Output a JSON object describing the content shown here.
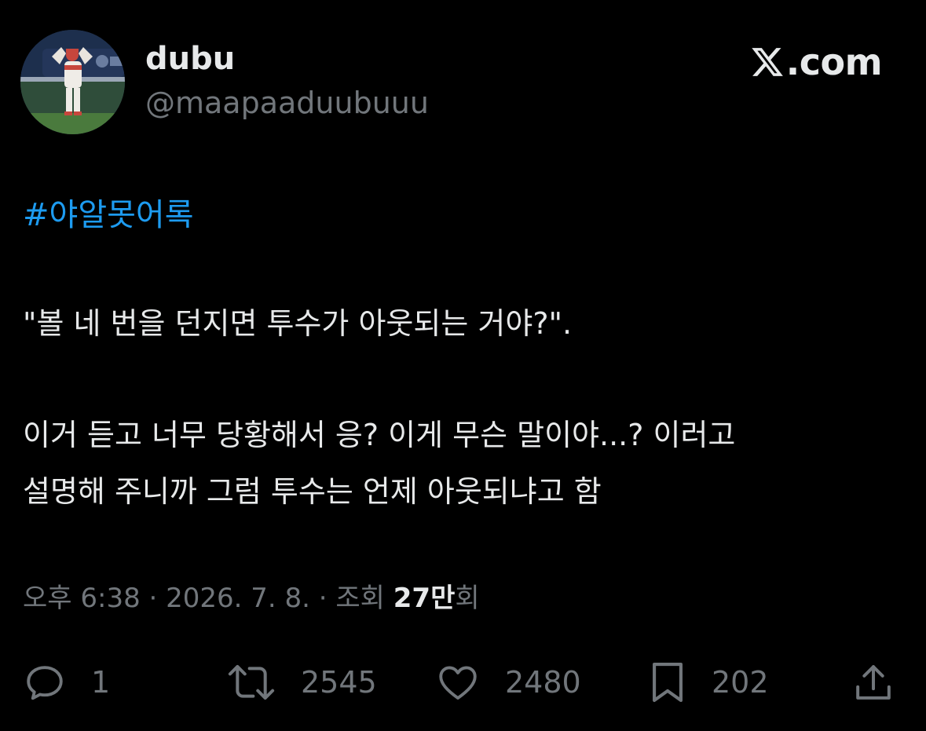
{
  "author": {
    "display_name": "dubu",
    "handle": "@maapaaduubuuu",
    "avatar_icon": "baseball-player-avatar"
  },
  "brand": {
    "icon": "x-logo-icon",
    "text": ".com"
  },
  "tweet": {
    "hashtag": "#야알못어록",
    "lines": [
      "\"볼 네 번을 던지면 투수가 아웃되는 거야?\".",
      "이거 듣고 너무 당황해서 응? 이게 무슨 말이야...? 이러고",
      "설명해 주니까 그럼 투수는 언제 아웃되냐고 함"
    ]
  },
  "meta": {
    "time": "오후 6:38 · 2026. 7. 8. · 조회 ",
    "views_count": "27만",
    "views_suffix": "회"
  },
  "actions": {
    "reply": {
      "icon": "reply-icon",
      "count": "1"
    },
    "retweet": {
      "icon": "retweet-icon",
      "count": "2545"
    },
    "like": {
      "icon": "heart-icon",
      "count": "2480"
    },
    "bookmark": {
      "icon": "bookmark-icon",
      "count": "202"
    },
    "share": {
      "icon": "share-icon"
    }
  },
  "colors": {
    "background": "#000000",
    "primary_text": "#e7e9ea",
    "secondary_text": "#71767b",
    "hashtag": "#1d9bf0"
  }
}
